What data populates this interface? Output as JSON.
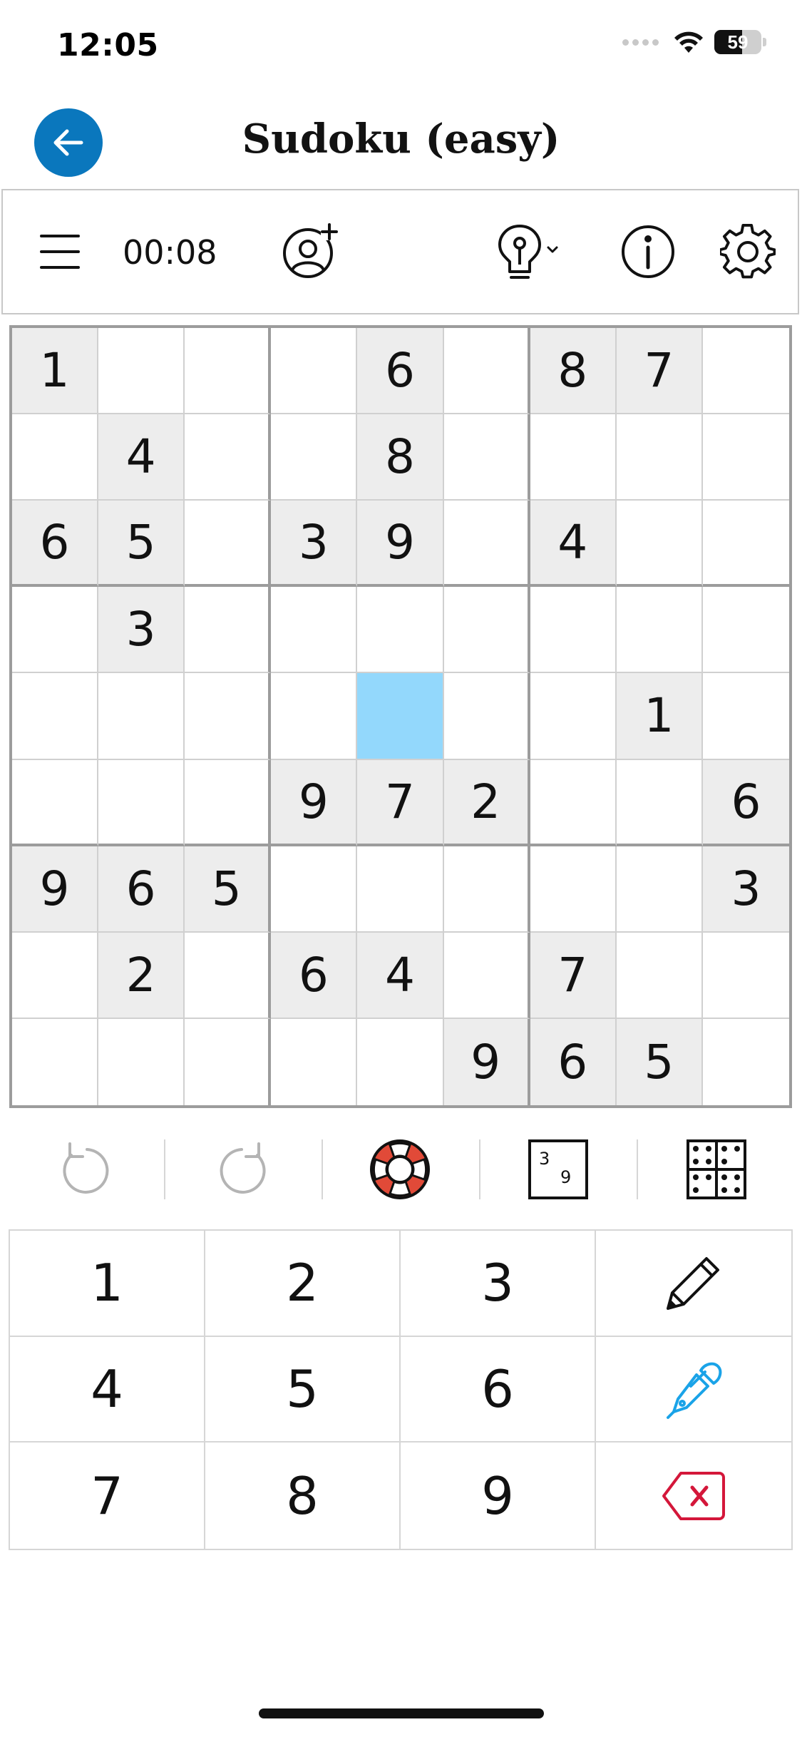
{
  "status_bar": {
    "time": "12:05",
    "battery": "59",
    "battery_level": 0.59
  },
  "header": {
    "title": "Sudoku (easy)",
    "back_icon": "arrow-left-icon",
    "back_color": "#0a77bd"
  },
  "toolbar": {
    "timer": "00:08",
    "icons": [
      "menu-icon",
      "add-user-icon",
      "hint-bulb-icon",
      "info-icon",
      "gear-icon"
    ]
  },
  "grid": {
    "rows": [
      [
        "1",
        "",
        "",
        "",
        "6",
        "",
        "8",
        "7",
        ""
      ],
      [
        "",
        "4",
        "",
        "",
        "8",
        "",
        "",
        "",
        ""
      ],
      [
        "6",
        "5",
        "",
        "3",
        "9",
        "",
        "4",
        "",
        ""
      ],
      [
        "",
        "3",
        "",
        "",
        "",
        "",
        "",
        "",
        ""
      ],
      [
        "",
        "",
        "",
        "",
        "",
        "",
        "",
        "1",
        ""
      ],
      [
        "",
        "",
        "",
        "9",
        "7",
        "2",
        "",
        "",
        "6"
      ],
      [
        "9",
        "6",
        "5",
        "",
        "",
        "",
        "",
        "",
        "3"
      ],
      [
        "",
        "2",
        "",
        "6",
        "4",
        "",
        "7",
        "",
        ""
      ],
      [
        "",
        "",
        "",
        "",
        "",
        "9",
        "6",
        "5",
        ""
      ]
    ],
    "selected": [
      4,
      4
    ],
    "colors": {
      "given": "#ededed",
      "selected": "#93d8fc",
      "box_border": "#9c9c9c",
      "cell_border": "#d0d0d0"
    }
  },
  "actions": {
    "icons": [
      "undo-icon",
      "redo-icon",
      "lifebuoy-icon",
      "candidates-icon",
      "grid-notes-icon"
    ]
  },
  "keypad": {
    "keys": [
      "1",
      "2",
      "3",
      "4",
      "5",
      "6",
      "7",
      "8",
      "9"
    ],
    "tools": [
      "pencil-icon",
      "pen-icon",
      "delete-icon"
    ],
    "pen_color": "#1aa3e8",
    "delete_color": "#d4173a"
  }
}
